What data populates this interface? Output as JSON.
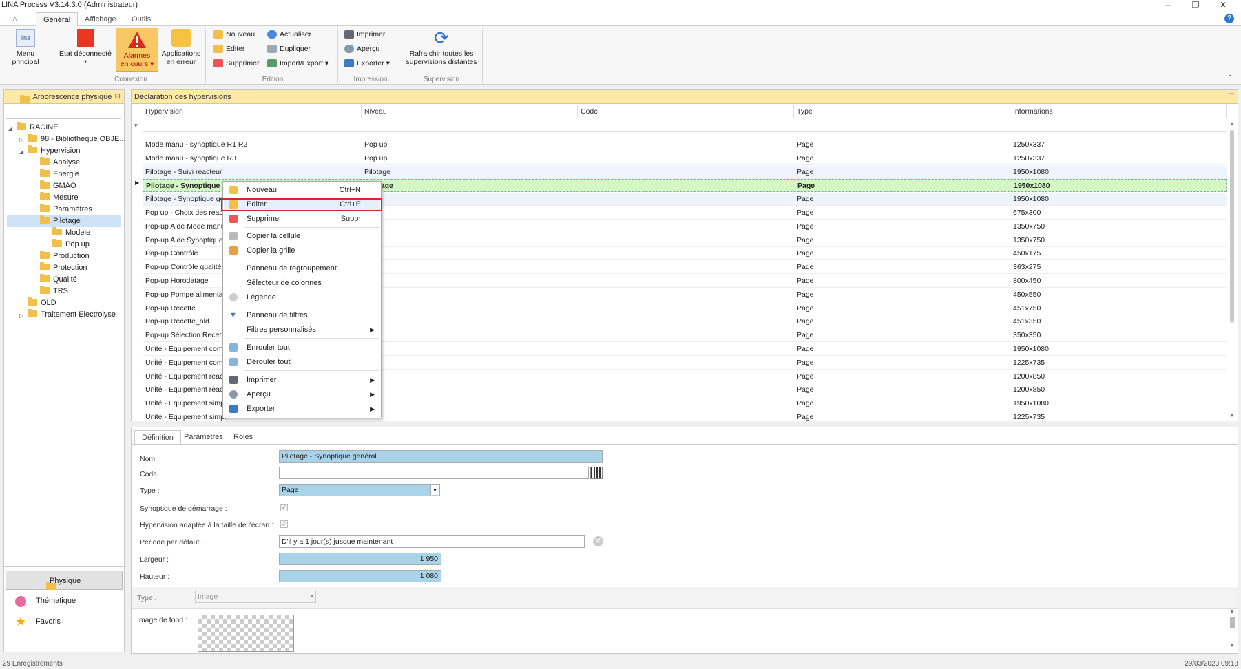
{
  "window": {
    "title": "LINA Process  V3.14.3.0  (Administrateur)"
  },
  "tabs": [
    {
      "label": "Général"
    },
    {
      "label": "Affichage"
    },
    {
      "label": "Outils"
    }
  ],
  "ribbon": {
    "menu_principal": "Menu principal",
    "etat": "Etat déconnecté",
    "alarmes_1": "Alarmes",
    "alarmes_2": "en cours",
    "applications_1": "Applications",
    "applications_2": "en erreur",
    "nouveau": "Nouveau",
    "editer": "Editer",
    "supprimer": "Supprimer",
    "actualiser": "Actualiser",
    "dupliquer": "Dupliquer",
    "import_export": "Import/Export",
    "imprimer": "Imprimer",
    "apercu": "Aperçu",
    "exporter": "Exporter",
    "rafraichir_1": "Rafraichir toutes les",
    "rafraichir_2": "supervisions distantes",
    "group_connexion": "Connexion",
    "group_edition": "Edition",
    "group_impression": "Impression",
    "group_supervision": "Supervision"
  },
  "left_panel": {
    "title": "Arborescence physique",
    "tree": [
      {
        "label": "RACINE"
      },
      {
        "label": "98 - Bibliotheque OBJE..."
      },
      {
        "label": "Hypervision"
      },
      {
        "label": "Analyse"
      },
      {
        "label": "Energie"
      },
      {
        "label": "GMAO"
      },
      {
        "label": "Mesure"
      },
      {
        "label": "Paramètres"
      },
      {
        "label": "Pilotage"
      },
      {
        "label": "Modele"
      },
      {
        "label": "Pop up"
      },
      {
        "label": "Production"
      },
      {
        "label": "Protection"
      },
      {
        "label": "Qualité"
      },
      {
        "label": "TRS"
      },
      {
        "label": "OLD"
      },
      {
        "label": "Traitement Electrolyse"
      }
    ],
    "nav": [
      {
        "label": "Physique"
      },
      {
        "label": "Thématique"
      },
      {
        "label": "Favoris"
      }
    ]
  },
  "grid": {
    "title": "Déclaration des hypervisions",
    "columns": [
      "Hypervision",
      "Niveau",
      "Code",
      "Type",
      "Informations"
    ],
    "rows": [
      {
        "hypervision": "Mode manu - synoptique R1 R2",
        "niveau": "Pop up",
        "code": "",
        "type": "Page",
        "info": "1250x337"
      },
      {
        "hypervision": "Mode manu - synoptique R3",
        "niveau": "Pop up",
        "code": "",
        "type": "Page",
        "info": "1250x337"
      },
      {
        "hypervision": "Pilotage - Suivi réacteur",
        "niveau": "Pilotage",
        "code": "",
        "type": "Page",
        "info": "1950x1080"
      },
      {
        "hypervision": "Pilotage - Synoptique général",
        "niveau": "Pilotage",
        "code": "",
        "type": "Page",
        "info": "1950x1080"
      },
      {
        "hypervision": "Pilotage - Synoptique gé",
        "niveau": "",
        "code": "",
        "type": "Page",
        "info": "1950x1080"
      },
      {
        "hypervision": "Pop up - Choix des reac",
        "niveau": "",
        "code": "",
        "type": "Page",
        "info": "675x300"
      },
      {
        "hypervision": "Pop-up Aide Mode manu",
        "niveau": "",
        "code": "",
        "type": "Page",
        "info": "1350x750"
      },
      {
        "hypervision": "Pop-up Aide Synoptique",
        "niveau": "",
        "code": "",
        "type": "Page",
        "info": "1350x750"
      },
      {
        "hypervision": "Pop-up Contrôle",
        "niveau": "",
        "code": "",
        "type": "Page",
        "info": "450x175"
      },
      {
        "hypervision": "Pop-up Contrôle qualité",
        "niveau": "",
        "code": "",
        "type": "Page",
        "info": "363x275"
      },
      {
        "hypervision": "Pop-up Horodatage",
        "niveau": "",
        "code": "",
        "type": "Page",
        "info": "800x450"
      },
      {
        "hypervision": "Pop-up Pompe alimentati",
        "niveau": "",
        "code": "",
        "type": "Page",
        "info": "450x550"
      },
      {
        "hypervision": "Pop-up Recette",
        "niveau": "",
        "code": "",
        "type": "Page",
        "info": "451x750"
      },
      {
        "hypervision": "Pop-up Recette_old",
        "niveau": "",
        "code": "",
        "type": "Page",
        "info": "451x350"
      },
      {
        "hypervision": "Pop-up Sélection Recette",
        "niveau": "",
        "code": "",
        "type": "Page",
        "info": "350x350"
      },
      {
        "hypervision": "Unité - Equipement comp",
        "niveau": "",
        "code": "",
        "type": "Page",
        "info": "1950x1080"
      },
      {
        "hypervision": "Unité - Equipement comp",
        "niveau": "",
        "code": "",
        "type": "Page",
        "info": "1225x735"
      },
      {
        "hypervision": "Unité - Equipement react",
        "niveau": "",
        "code": "",
        "type": "Page",
        "info": "1200x850"
      },
      {
        "hypervision": "Unité - Equipement react",
        "niveau": "",
        "code": "",
        "type": "Page",
        "info": "1200x850"
      },
      {
        "hypervision": "Unité - Equipement simpl",
        "niveau": "",
        "code": "",
        "type": "Page",
        "info": "1950x1080"
      },
      {
        "hypervision": "Unité - Equipement simpl",
        "niveau": "",
        "code": "",
        "type": "Page",
        "info": "1225x735"
      }
    ]
  },
  "context_menu": [
    {
      "label": "Nouveau",
      "shortcut": "Ctrl+N"
    },
    {
      "label": "Editer",
      "shortcut": "Ctrl+E"
    },
    {
      "label": "Supprimer",
      "shortcut": "Suppr"
    },
    {
      "label": "Copier la cellule",
      "shortcut": ""
    },
    {
      "label": "Copier la grille",
      "shortcut": ""
    },
    {
      "label": "Panneau de regroupement",
      "shortcut": ""
    },
    {
      "label": "Sélecteur de colonnes",
      "shortcut": ""
    },
    {
      "label": "Légende",
      "shortcut": ""
    },
    {
      "label": "Panneau de filtres",
      "shortcut": ""
    },
    {
      "label": "Filtres personnalisés",
      "shortcut": ""
    },
    {
      "label": "Enrouler tout",
      "shortcut": ""
    },
    {
      "label": "Dérouler tout",
      "shortcut": ""
    },
    {
      "label": "Imprimer",
      "shortcut": ""
    },
    {
      "label": "Aperçu",
      "shortcut": ""
    },
    {
      "label": "Exporter",
      "shortcut": ""
    }
  ],
  "detail": {
    "tabs": [
      "Définition",
      "Paramètres",
      "Rôles"
    ],
    "nom_label": "Nom :",
    "nom_value": "Pilotage - Synoptique général",
    "code_label": "Code :",
    "type_label": "Type :",
    "type_value": "Page",
    "synoptique_label": "Synoptique de démarrage :",
    "adaptee_label": "Hypervision adaptée à la taille de l'écran :",
    "periode_label": "Période par défaut :",
    "periode_value": "D'il y a 1 jour(s) jusque maintenant",
    "largeur_label": "Largeur :",
    "largeur_value": "1 950",
    "hauteur_label": "Hauteur :",
    "hauteur_value": "1 080",
    "type2_label": "Type :",
    "type2_value": "Image",
    "image_label": "Image de fond :"
  },
  "status": {
    "left": "29 Enregistrements",
    "right": "29/03/2023 09:18"
  },
  "colors": {
    "accent": "#fde9a8",
    "highlight_row": "#d4f7c4",
    "field_blue": "#a9d3e8",
    "red_box": "#d9262c"
  }
}
